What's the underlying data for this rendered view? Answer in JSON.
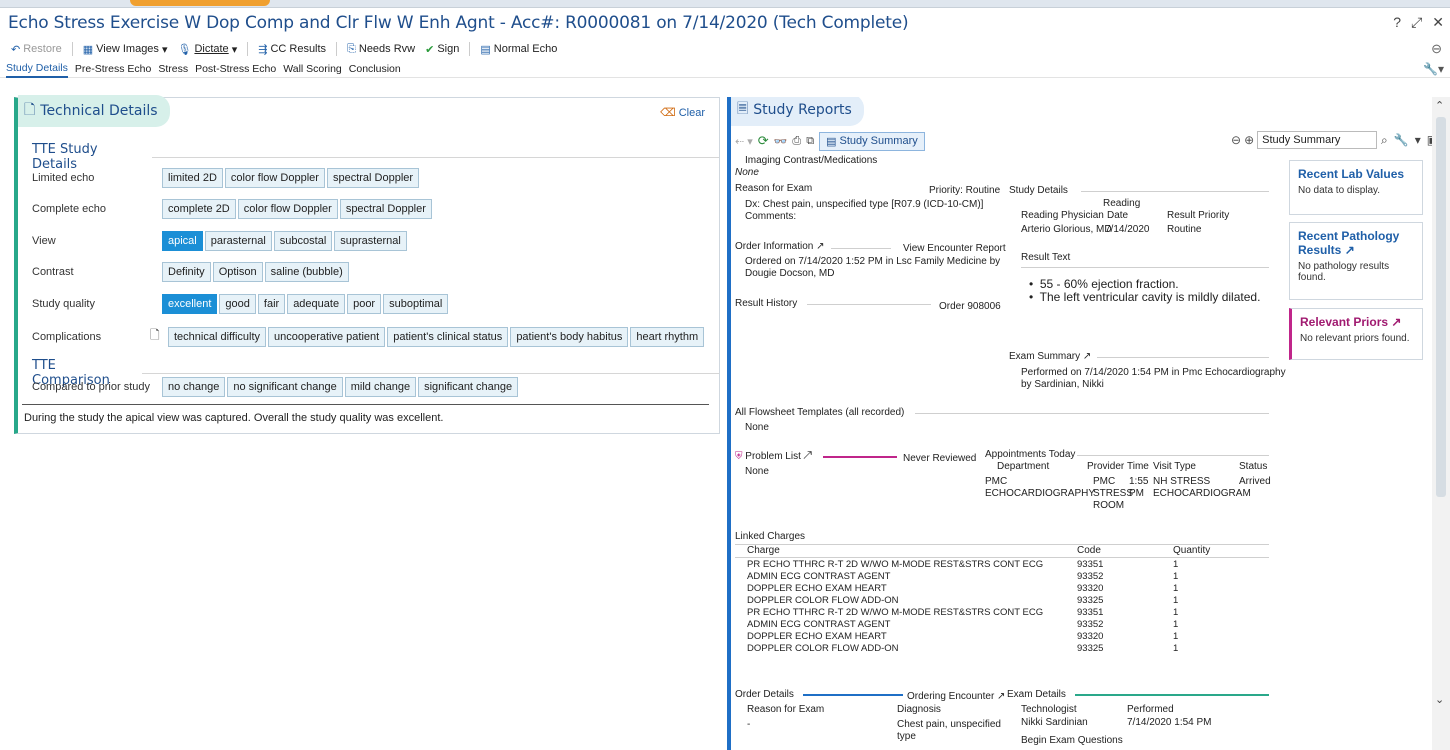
{
  "window": {
    "title": "Echo Stress Exercise W Dop Comp and Clr Flw W Enh Agnt - Acc#: R0000081 on 7/14/2020 (Tech Complete)"
  },
  "icons": {
    "help": "help-icon",
    "pin": "pin-icon",
    "close": "close-icon"
  },
  "toolbar": {
    "restore": "Restore",
    "view_images": "View Images",
    "dictate": "Dictate",
    "cc_results": "CC Results",
    "needs_rvw": "Needs Rvw",
    "sign": "Sign",
    "normal_echo": "Normal Echo"
  },
  "tabs": [
    "Study Details",
    "Pre-Stress Echo",
    "Stress",
    "Post-Stress Echo",
    "Wall Scoring",
    "Conclusion"
  ],
  "technical": {
    "header": "Technical Details",
    "clear": "Clear",
    "section1": "TTE Study Details",
    "rows": {
      "limited": {
        "label": "Limited echo",
        "options": [
          "limited 2D",
          "color flow Doppler",
          "spectral Doppler"
        ]
      },
      "complete": {
        "label": "Complete echo",
        "options": [
          "complete 2D",
          "color flow Doppler",
          "spectral Doppler"
        ]
      },
      "view": {
        "label": "View",
        "options": [
          "apical",
          "parasternal",
          "subcostal",
          "suprasternal"
        ]
      },
      "contrast": {
        "label": "Contrast",
        "options": [
          "Definity",
          "Optison",
          "saline (bubble)"
        ]
      },
      "quality": {
        "label": "Study quality",
        "options": [
          "excellent",
          "good",
          "fair",
          "adequate",
          "poor",
          "suboptimal"
        ]
      },
      "complications": {
        "label": "Complications",
        "options": [
          "technical difficulty",
          "uncooperative patient",
          "patient's clinical status",
          "patient's body habitus",
          "heart rhythm"
        ]
      }
    },
    "section2": "TTE Comparison",
    "comparison": {
      "label": "Compared to prior study",
      "options": [
        "no change",
        "no significant change",
        "mild change",
        "significant change"
      ]
    },
    "narrative": "During the study the apical view was captured. Overall the study quality was excellent."
  },
  "reports": {
    "header": "Study Reports",
    "summary_button": "Study Summary",
    "search_value": "Study Summary",
    "imaging_contrast": "Imaging Contrast/Medications",
    "none": "None",
    "reason_title": "Reason for Exam",
    "priority": "Priority: Routine",
    "dx": "Dx: Chest pain, unspecified type [R07.9 (ICD-10-CM)]",
    "comments": "Comments:",
    "order_info_title": "Order Information",
    "view_encounter": "View Encounter Report",
    "ordered_on": "Ordered on 7/14/2020  1:52 PM in Lsc Family Medicine by",
    "ordered_by": "Dougie Docson, MD",
    "result_history": "Result History",
    "order_no": "Order 908006",
    "study_details_title": "Study Details",
    "sd_headers": {
      "physician": "Reading Physician",
      "reading": "Reading",
      "date": "Date",
      "priority": "Result Priority"
    },
    "sd_values": {
      "physician": "Arterio Glorious, MD",
      "date": "7/14/2020",
      "priority": "Routine"
    },
    "result_text_title": "Result Text",
    "result_bullets": [
      "55 - 60% ejection fraction.",
      "The left ventricular cavity is mildly dilated."
    ],
    "exam_summary_title": "Exam Summary",
    "exam_performed": "Performed on 7/14/2020  1:54 PM in Pmc Echocardiography",
    "exam_by": "by Sardinian, Nikki",
    "flowsheet_title": "All Flowsheet Templates (all recorded)",
    "flowsheet_none": "None",
    "problem_list": "Problem List",
    "never_reviewed": "Never Reviewed",
    "problem_none": "None",
    "appointments_title": "Appointments Today",
    "appt_headers": {
      "department": "Department",
      "provider": "Provider",
      "time": "Time",
      "visit": "Visit Type",
      "status": "Status"
    },
    "appt": {
      "dept1": "PMC",
      "dept2": "ECHOCARDIOGRAPHY",
      "prov1": "PMC",
      "prov2": "STRESS",
      "prov3": "ROOM",
      "time1": "1:55",
      "time2": "PM",
      "visit1": "NH STRESS",
      "visit2": "ECHOCARDIOGRAM",
      "status": "Arrived"
    },
    "charges_title": "Linked Charges",
    "charges_headers": {
      "charge": "Charge",
      "code": "Code",
      "qty": "Quantity"
    },
    "charges": [
      {
        "charge": "PR ECHO TTHRC R-T 2D W/WO M-MODE REST&STRS CONT ECG",
        "code": "93351",
        "qty": "1"
      },
      {
        "charge": "ADMIN ECG CONTRAST AGENT",
        "code": "93352",
        "qty": "1"
      },
      {
        "charge": "DOPPLER ECHO EXAM HEART",
        "code": "93320",
        "qty": "1"
      },
      {
        "charge": "DOPPLER COLOR FLOW ADD-ON",
        "code": "93325",
        "qty": "1"
      },
      {
        "charge": "PR ECHO TTHRC R-T 2D W/WO M-MODE REST&STRS CONT ECG",
        "code": "93351",
        "qty": "1"
      },
      {
        "charge": "ADMIN ECG CONTRAST AGENT",
        "code": "93352",
        "qty": "1"
      },
      {
        "charge": "DOPPLER ECHO EXAM HEART",
        "code": "93320",
        "qty": "1"
      },
      {
        "charge": "DOPPLER COLOR FLOW ADD-ON",
        "code": "93325",
        "qty": "1"
      }
    ],
    "order_details_title": "Order Details",
    "ordering_encounter": "Ordering Encounter",
    "od_headers": {
      "reason": "Reason for Exam",
      "diagnosis": "Diagnosis"
    },
    "od_values": {
      "reason": "-",
      "diag1": "Chest pain, unspecified",
      "diag2": "type"
    },
    "exam_details_title": "Exam Details",
    "ed_headers": {
      "tech": "Technologist",
      "performed": "Performed"
    },
    "ed_values": {
      "tech": "Nikki Sardinian",
      "performed": "7/14/2020 1:54 PM"
    },
    "begin_questions": "Begin Exam Questions"
  },
  "side": {
    "lab_title": "Recent Lab Values",
    "lab_text": "No data to display.",
    "path_title": "Recent Pathology Results",
    "path_text": "No pathology results found.",
    "priors_title": "Relevant Priors",
    "priors_text": "No relevant priors found."
  }
}
